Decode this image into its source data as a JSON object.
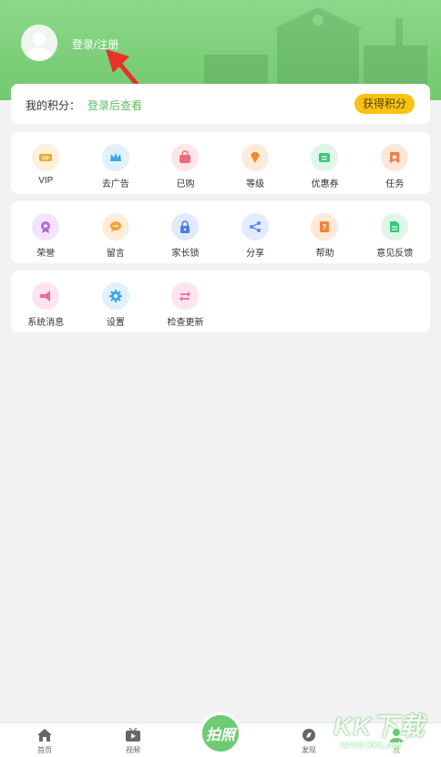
{
  "header": {
    "login_text": "登录/注册"
  },
  "points": {
    "label": "我的积分：",
    "value": "登录后查看",
    "button": "获得积分"
  },
  "grid": {
    "row1": [
      {
        "label": "VIP",
        "icon": "vip-icon",
        "color": "#f5a623",
        "bg": "#fdf1dc"
      },
      {
        "label": "去广告",
        "icon": "crown-icon",
        "color": "#3aa7f0",
        "bg": "#e1f1fc"
      },
      {
        "label": "已购",
        "icon": "shopping-bag-icon",
        "color": "#f06a7a",
        "bg": "#fde5e8"
      },
      {
        "label": "等级",
        "icon": "diamond-icon",
        "color": "#f7872d",
        "bg": "#fdebdc"
      },
      {
        "label": "优惠券",
        "icon": "coupon-icon",
        "color": "#3cc77d",
        "bg": "#dff6e9"
      },
      {
        "label": "任务",
        "icon": "task-icon",
        "color": "#f37b45",
        "bg": "#fde6da"
      }
    ],
    "row2": [
      {
        "label": "荣誉",
        "icon": "medal-icon",
        "color": "#b06ae0",
        "bg": "#f1e4fb"
      },
      {
        "label": "留言",
        "icon": "message-icon",
        "color": "#f7a23b",
        "bg": "#fdeedb"
      },
      {
        "label": "家长锁",
        "icon": "lock-icon",
        "color": "#4c7cf0",
        "bg": "#e2eafd"
      },
      {
        "label": "分享",
        "icon": "share-icon",
        "color": "#5f86f2",
        "bg": "#e4ebfd"
      },
      {
        "label": "帮助",
        "icon": "help-icon",
        "color": "#f2853d",
        "bg": "#fde8da"
      },
      {
        "label": "意见反馈",
        "icon": "feedback-icon",
        "color": "#3cc77d",
        "bg": "#dff6e9"
      }
    ],
    "row3": [
      {
        "label": "系统消息",
        "icon": "megaphone-icon",
        "color": "#f06a9a",
        "bg": "#fde4ee"
      },
      {
        "label": "设置",
        "icon": "gear-icon",
        "color": "#3aa7f0",
        "bg": "#e1f1fc"
      },
      {
        "label": "检查更新",
        "icon": "refresh-icon",
        "color": "#f06aa8",
        "bg": "#fde4f0"
      }
    ]
  },
  "tabbar": {
    "home": "首页",
    "video": "视频",
    "center": "拍照",
    "discover": "发现",
    "mine": "我"
  },
  "watermark": {
    "text": "KK下载",
    "url": "www.kkx.net"
  },
  "colors": {
    "accent": "#6ccb73",
    "header": "#7ccf79",
    "button": "#f9c316"
  }
}
